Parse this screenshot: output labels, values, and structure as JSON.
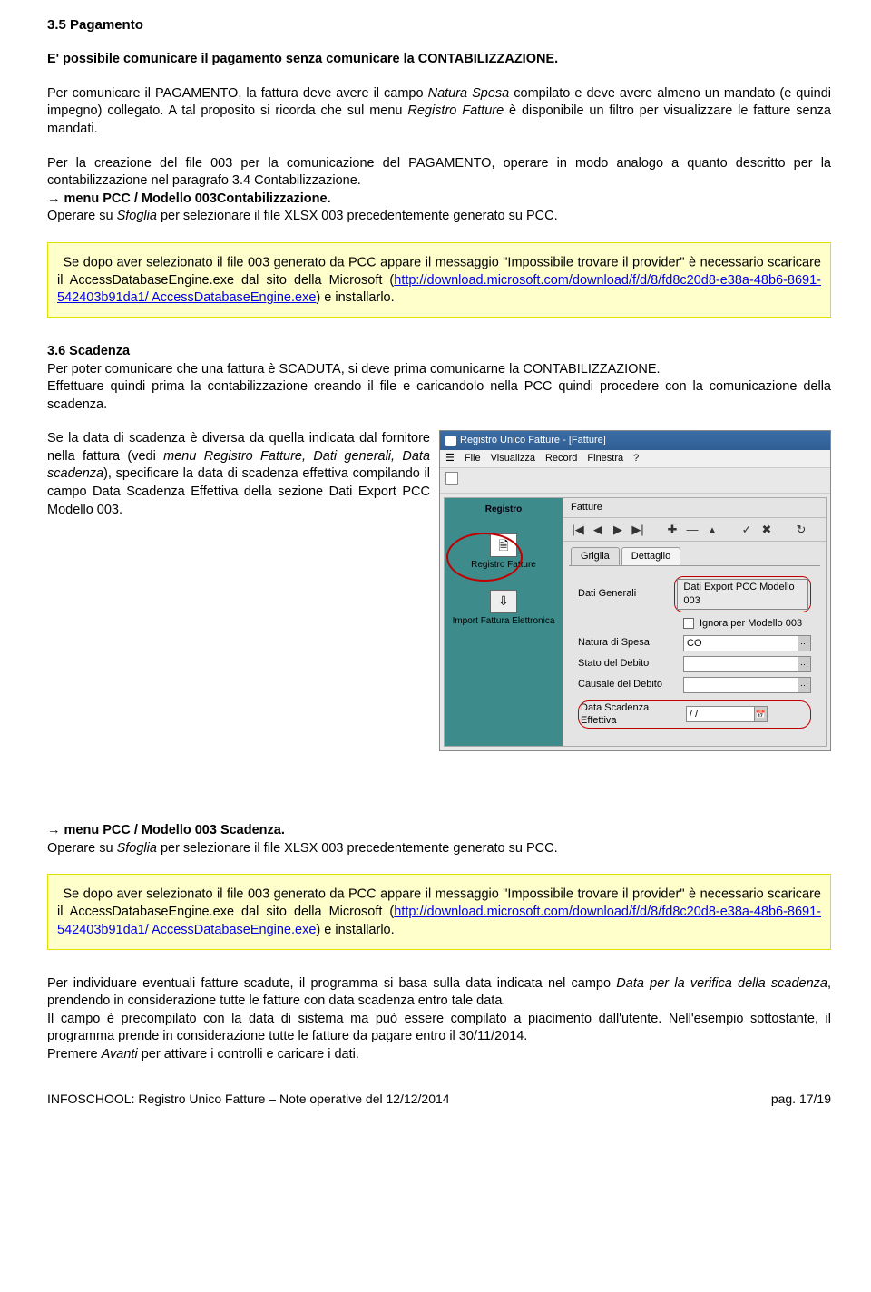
{
  "section_pagamento": {
    "heading": "3.5 Pagamento",
    "intro": "E' possibile comunicare il pagamento senza comunicare la CONTABILIZZAZIONE.",
    "p1a": "Per comunicare il PAGAMENTO, la fattura deve avere il campo ",
    "p1b": "Natura Spesa",
    "p1c": " compilato e deve avere almeno un mandato (e quindi impegno) collegato. A tal proposito si ricorda che sul menu ",
    "p1d": "Registro Fatture",
    "p1e": " è disponibile un filtro per visualizzare le fatture senza mandati.",
    "p2a": "Per la creazione del file 003 per la comunicazione del PAGAMENTO, operare in modo analogo a quanto descritto per la contabilizzazione nel paragrafo 3.4  Contabilizzazione.",
    "p2b": "→ menu PCC / Modello 003Contabilizzazione.",
    "p2c": "Operare su ",
    "p2d": "Sfoglia",
    "p2e": " per selezionare il file XLSX 003 precedentemente generato su PCC."
  },
  "warn1": {
    "t1": "Se dopo aver selezionato il file 003 generato da PCC appare il messaggio \"Impossibile trovare il provider\" è necessario scaricare il AccessDatabaseEngine.exe dal sito della Microsoft (",
    "link1": "http://download.microsoft.com/download/f/d/8/fd8c20d8-e38a-48b6-8691-542403b91da1/ AccessDatabaseEngine.exe",
    "t3": ") e installarlo."
  },
  "section_scadenza": {
    "heading": "3.6 Scadenza",
    "p1": "Per poter comunicare che una fattura è SCADUTA, si deve prima comunicarne la CONTABILIZZAZIONE.",
    "p2": "Effettuare quindi prima la contabilizzazione creando il file e caricandolo nella PCC quindi procedere con la comunicazione della scadenza.",
    "p3a": "Se la data di scadenza è diversa da quella indicata dal fornitore nella fattura (vedi ",
    "p3b": "menu Registro Fatture, Dati generali, Data scadenza",
    "p3c": "), specificare la data di scadenza effettiva compilando il campo Data Scadenza Effettiva della sezione Dati Export PCC Modello 003.",
    "p4": "→ menu PCC / Modello 003 Scadenza.",
    "p5a": "Operare su ",
    "p5b": "Sfoglia",
    "p5c": " per selezionare il file XLSX 003 precedentemente generato su PCC."
  },
  "warn2": {
    "t1": "Se dopo aver selezionato il file 003 generato da PCC appare il messaggio \"Impossibile trovare il provider\" è necessario scaricare il AccessDatabaseEngine.exe dal sito della Microsoft (",
    "link1": "http://download.microsoft.com/download/f/d/8/fd8c20d8-e38a-48b6-8691-542403b91da1/ AccessDatabaseEngine.exe",
    "t3": ") e installarlo."
  },
  "p_after": {
    "a1": "Per individuare eventuali fatture scadute, il programma si basa sulla data indicata nel campo ",
    "a2": "Data per la verifica della scadenza",
    "a3": ", prendendo in considerazione tutte le fatture con data scadenza entro tale data.",
    "b": "Il campo è precompilato con la data di sistema ma può essere compilato a piacimento dall'utente. Nell'esempio sottostante, il programma prende in considerazione tutte le fatture da pagare entro il 30/11/2014.",
    "c1": "Premere ",
    "c2": "Avanti",
    "c3": " per attivare i controlli e caricare i dati."
  },
  "screenshot": {
    "title": "Registro Unico Fatture - [Fatture]",
    "menu": [
      "File",
      "Visualizza",
      "Record",
      "Finestra",
      "?"
    ],
    "inner_subtitle": "Fatture",
    "side": {
      "head": "Registro",
      "item1": "Registro Fatture",
      "item2": "Import Fattura Elettronica"
    },
    "toolbar_icons": [
      "|◀",
      "◀",
      "▶",
      "▶|",
      "✚",
      "—",
      "▴",
      "✓",
      "✖",
      "↻"
    ],
    "tabs": {
      "t1": "Griglia",
      "t2": "Dettaglio"
    },
    "sub_button": "Dati Export PCC Modello 003",
    "subheader": "Dati Generali",
    "chk_label": "Ignora per Modello 003",
    "rows": {
      "r1": "Natura di Spesa",
      "r1v": "CO",
      "r2": "Stato del Debito",
      "r3": "Causale del Debito",
      "r4": "Data Scadenza Effettiva",
      "r4v": "/  /"
    }
  },
  "footer": {
    "left": "INFOSCHOOL: Registro Unico Fatture – Note operative del 12/12/2014",
    "right": "pag. 17/19"
  }
}
